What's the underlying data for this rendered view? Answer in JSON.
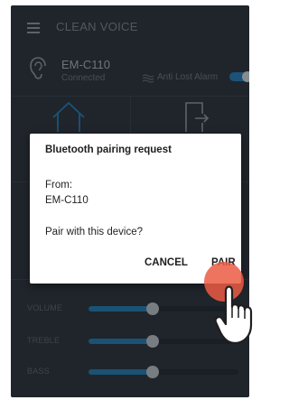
{
  "app": {
    "title": "CLEAN VOICE"
  },
  "device": {
    "name": "EM-C110",
    "status": "Connected"
  },
  "alarm": {
    "label": "Anti Lost Alarm",
    "enabled": true
  },
  "sliders": [
    {
      "label": "VOLUME",
      "level": 0.43
    },
    {
      "label": "TREBLE",
      "level": 0.43
    },
    {
      "label": "BASS",
      "level": 0.43
    }
  ],
  "dialog": {
    "title": "Bluetooth pairing request",
    "from_label": "From:",
    "device": "EM-C110",
    "question": "Pair with this device?",
    "cancel_label": "CANCEL",
    "pair_label": "PAIR"
  },
  "colors": {
    "background": "#303943",
    "accent": "#2a7fb3",
    "touch": "#ec5c44"
  }
}
